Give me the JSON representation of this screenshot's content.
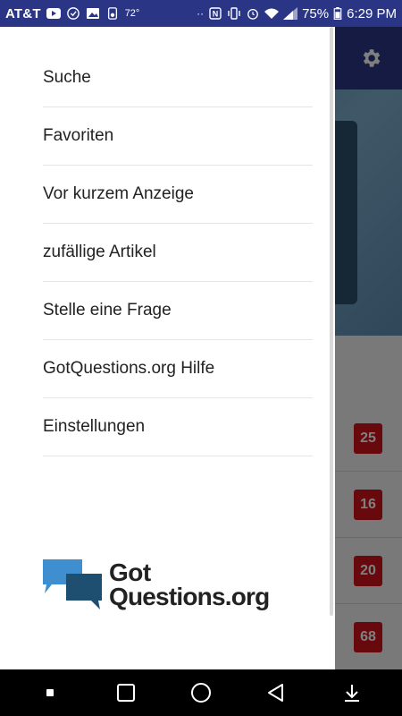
{
  "status_bar": {
    "carrier": "AT&T",
    "temperature": "72°",
    "battery": "75%",
    "time": "6:29 PM"
  },
  "drawer": {
    "menu_items": [
      {
        "label": "Suche"
      },
      {
        "label": "Favoriten"
      },
      {
        "label": "Vor kurzem Anzeige"
      },
      {
        "label": "zufällige Artikel"
      },
      {
        "label": "Stelle eine Frage"
      },
      {
        "label": "GotQuestions.org Hilfe"
      },
      {
        "label": "Einstellungen"
      }
    ],
    "logo": {
      "line1": "Got",
      "line2": "Questions.org"
    }
  },
  "background": {
    "badges": [
      "25",
      "16",
      "20",
      "68"
    ]
  },
  "colors": {
    "toolbar": "#2d3786",
    "badge": "#d0131a",
    "logo_light_blue": "#3f8fd0",
    "logo_dark_blue": "#1f4f70"
  }
}
